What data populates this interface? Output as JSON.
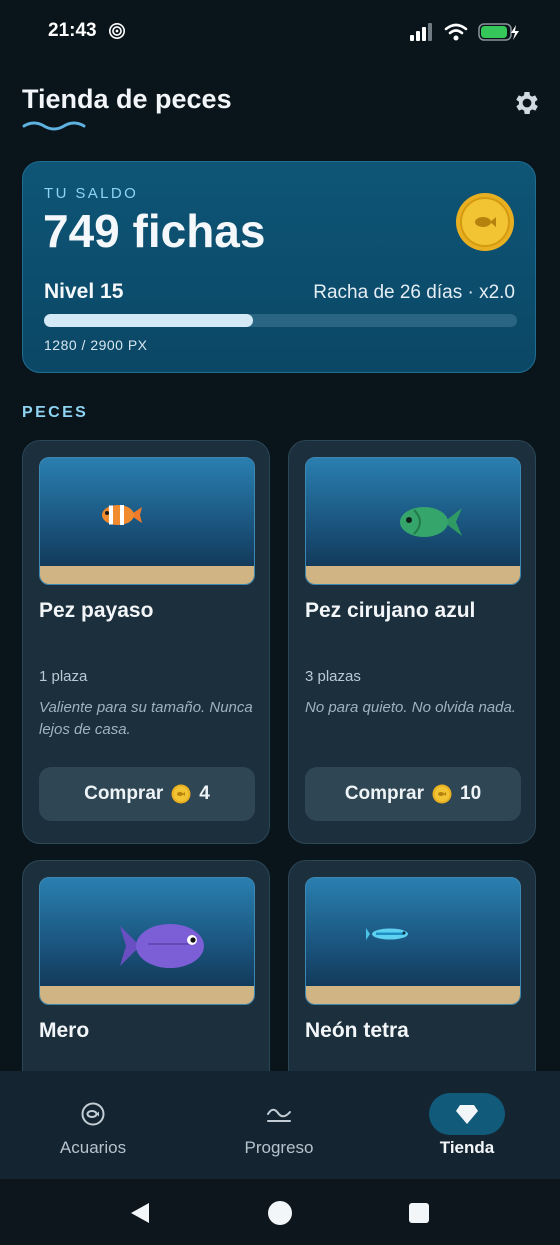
{
  "status_bar": {
    "time": "21:43"
  },
  "header": {
    "title": "Tienda de peces",
    "settings_icon": "gear-icon"
  },
  "balance": {
    "label": "TU SALDO",
    "value": "749 fichas",
    "level": "Nivel 15",
    "streak": "Racha de 26 días · x2.0",
    "xp_text": "1280 / 2900 PX",
    "xp_progress": 0.441
  },
  "section": {
    "title": "PECES"
  },
  "fish": [
    {
      "name": "Pez payaso",
      "slots": "1 plaza",
      "description": "Valiente para su tamaño. Nunca lejos de casa.",
      "buy_label": "Comprar",
      "price": "4"
    },
    {
      "name": "Pez cirujano azul",
      "slots": "3 plazas",
      "description": "No para quieto. No olvida nada.",
      "buy_label": "Comprar",
      "price": "10"
    },
    {
      "name": "Mero"
    },
    {
      "name": "Neón tetra"
    }
  ],
  "nav": {
    "items": [
      {
        "label": "Acuarios",
        "icon": "aquarium-icon"
      },
      {
        "label": "Progreso",
        "icon": "progress-icon"
      },
      {
        "label": "Tienda",
        "icon": "diamond-icon",
        "active": true
      }
    ]
  },
  "colors": {
    "accent": "#115a7a",
    "coin": "#e8b021",
    "card": "#1b2f3c"
  }
}
